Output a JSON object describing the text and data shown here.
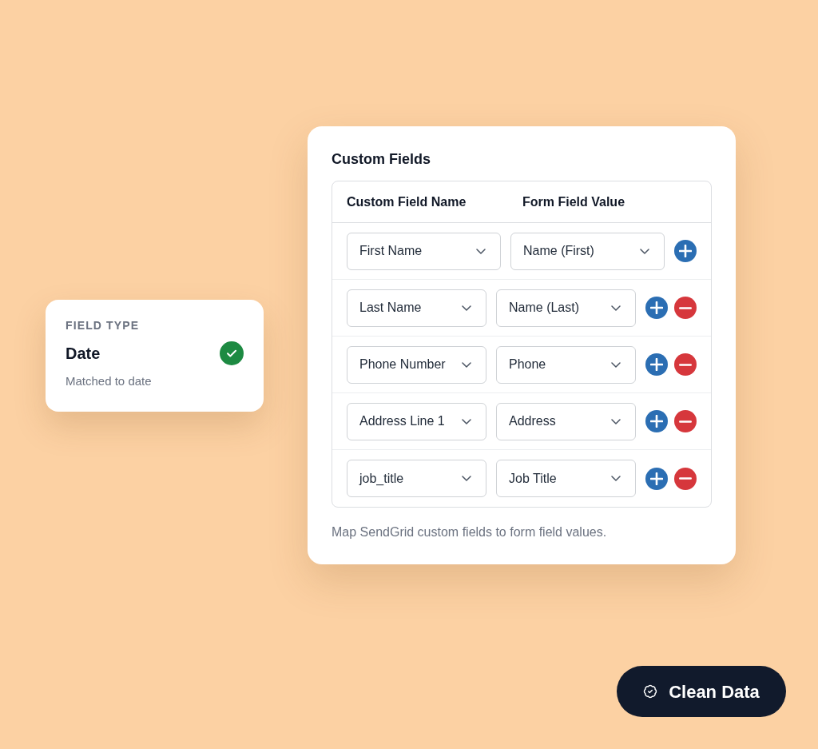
{
  "field_type_card": {
    "label": "FIELD TYPE",
    "value": "Date",
    "matched": true,
    "note": "Matched to date"
  },
  "custom_fields": {
    "title": "Custom Fields",
    "columns": [
      "Custom Field Name",
      "Form Field Value"
    ],
    "rows": [
      {
        "name": "First Name",
        "value": "Name (First)",
        "removable": false
      },
      {
        "name": "Last Name",
        "value": "Name (Last)",
        "removable": true
      },
      {
        "name": "Phone Number",
        "value": "Phone",
        "removable": true
      },
      {
        "name": "Address Line 1",
        "value": "Address",
        "removable": true
      },
      {
        "name": "job_title",
        "value": "Job Title",
        "removable": true
      }
    ],
    "help_text": "Map SendGrid custom fields to form field values."
  },
  "action_button": {
    "label": "Clean Data"
  }
}
